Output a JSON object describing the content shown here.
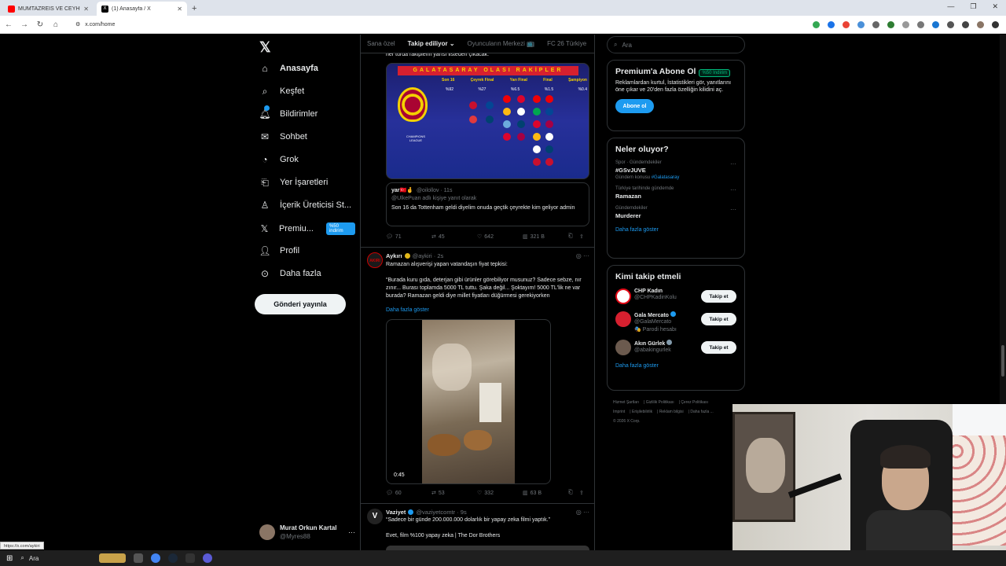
{
  "browser": {
    "tabs": [
      {
        "label": "MÜMTAZREİS VE CEYHUN ABİ",
        "fav_color": "#ff0000"
      },
      {
        "label": "(1) Anasayfa / X",
        "fav_color": "#000000"
      }
    ],
    "new_tab": "+",
    "url": "x.com/home",
    "status_url": "https://x.com/aykiri"
  },
  "nav": {
    "items": [
      {
        "label": "Anasayfa",
        "icon": "home-icon"
      },
      {
        "label": "Keşfet",
        "icon": "search-icon"
      },
      {
        "label": "Bildirimler",
        "icon": "bell-icon"
      },
      {
        "label": "Sohbet",
        "icon": "mail-icon"
      },
      {
        "label": "Grok",
        "icon": "grok-icon"
      },
      {
        "label": "Yer İşaretleri",
        "icon": "bookmark-icon"
      },
      {
        "label": "İçerik Üreticisi St...",
        "icon": "creator-icon"
      },
      {
        "label": "Premiu...",
        "icon": "x-icon",
        "badge": "%50 indirim"
      },
      {
        "label": "Profil",
        "icon": "profile-icon"
      },
      {
        "label": "Daha fazla",
        "icon": "more-icon"
      }
    ],
    "post_button": "Gönderi yayınla",
    "account": {
      "name": "Murat Orkun Kartal",
      "handle": "@Myres88"
    }
  },
  "feed": {
    "tabs": [
      "Sana özel",
      "Takip ediliyor",
      "Oyuncuların Merkezi 📺",
      "FC 26 Türkiye"
    ],
    "top_fragment": "her turda rakiplerin yarısı listeden çıkacak.",
    "graphic": {
      "title": "GALATASARAY OLASI RAKİPLER",
      "phases": [
        "Son 16",
        "Çeyrek Final",
        "Yarı Final",
        "Final",
        "Şampiyon"
      ],
      "pcts": [
        "%92",
        "%27",
        "%6.5",
        "%1.5",
        "%0.4"
      ],
      "league": "CHAMPIONS LEAGUE"
    },
    "quote": {
      "name": "yar🇹🇷🤞",
      "handle": "@oilollov · 11s",
      "reply": "@UlkePuan adlı kişiye yanıt olarak",
      "text": "Son 16 da Tottenham geldi diyelim onuda geçtik çeyrekte kim geliyor admin"
    },
    "actions1": {
      "replies": "71",
      "reposts": "45",
      "likes": "642",
      "views": "321 B"
    },
    "tweet2": {
      "name": "Aykırı",
      "handle": "@aykiri · 2s",
      "line1": "Ramazan alışverişi yapan vatandaşın fiyat tepkisi:",
      "body": "“Burada kuru gıda, deterjan gibi ürünler görebiliyor musunuz? Sadece sebze, nır zınır... Burası toplamda 5000 TL tuttu. Şaka değil... Şoktayım! 5000 TL'lik ne var burada? Ramazan geldi diye millet fiyatları düğürmesi gerekiyorken",
      "show_more": "Daha fazla göster",
      "video_time": "0:45",
      "actions": {
        "replies": "60",
        "reposts": "53",
        "likes": "332",
        "views": "63 B"
      }
    },
    "tweet3": {
      "name": "Vaziyet",
      "handle": "@vaziyetcomtr · 9s",
      "line1": "“Sadece bir günde 200.000.000 dolarlık bir yapay zeka filmi yaptık.”",
      "line2": "Evet, film %100 yapay zeka | The Dor Brothers"
    }
  },
  "right": {
    "search_placeholder": "Ara",
    "premium": {
      "title": "Premium'a Abone Ol",
      "badge": "%50 İndirim",
      "text": "Reklamlardan kurtul, İstatistikleri gör, yanıtlarını öne çıkar ve 20'den fazla özelliğin kilidini aç.",
      "button": "Abone ol"
    },
    "trends": {
      "title": "Neler oluyor?",
      "items": [
        {
          "context": "Spor · Gündemdekiler",
          "name": "#GSvJUVE",
          "extra_pre": "Gündem konusu ",
          "extra_link": "#Galatasaray"
        },
        {
          "context": "Türkiye tarihinde gündemde",
          "name": "Ramazan",
          "extra_pre": "",
          "extra_link": ""
        },
        {
          "context": "Gündemdekiler",
          "name": "Murderer",
          "extra_pre": "",
          "extra_link": ""
        }
      ],
      "show_more": "Daha fazla göster"
    },
    "follow": {
      "title": "Kimi takip etmeli",
      "items": [
        {
          "name": "CHP Kadın",
          "handle": "@CHPKadinKolu",
          "note": "",
          "button": "Takip et",
          "color": "#e30a17"
        },
        {
          "name": "Gala Mercato",
          "handle": "@GalaMercato",
          "note": "🎭 Parodi hesabı",
          "button": "Takip et",
          "color": "#d6202f"
        },
        {
          "name": "Akın Gürlek",
          "handle": "@abakingurlek",
          "note": "",
          "button": "Takip et",
          "color": "#6b5a4e"
        }
      ],
      "show_more": "Daha fazla göster"
    },
    "footer": [
      "Hizmet Şartları",
      "Gizlilik Politikası",
      "Çerez Politikası",
      "Imprint",
      "Erişilebilirlik",
      "Reklam bilgisi",
      "Daha fazla ...",
      "© 2026 X Corp."
    ]
  },
  "taskbar": {
    "search": "Ara"
  }
}
